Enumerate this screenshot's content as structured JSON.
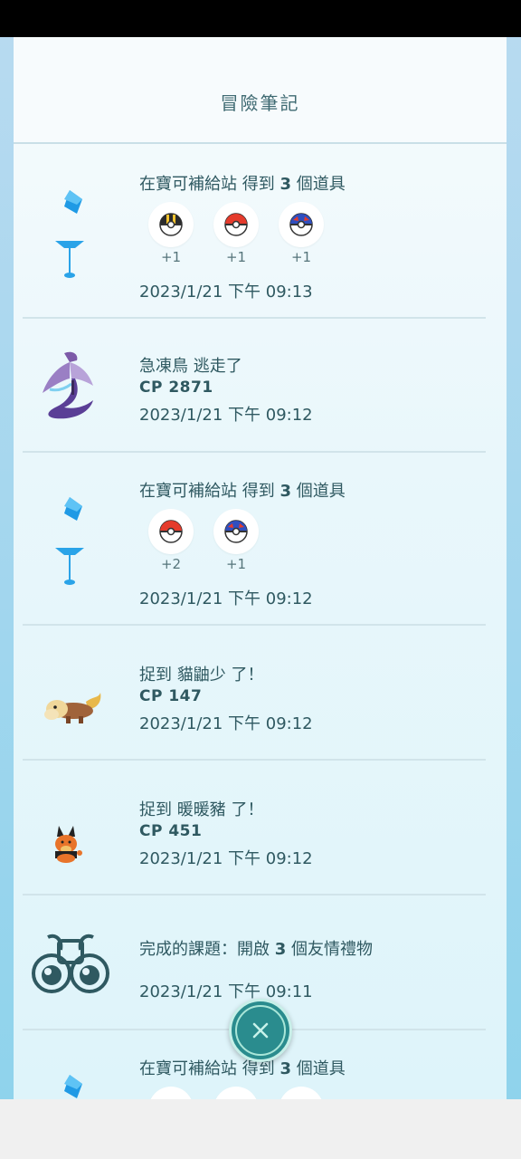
{
  "header": {
    "title": "冒險筆記"
  },
  "entries": [
    {
      "title_pre": "在寶可補給站  得到 ",
      "title_num": "3",
      "title_post": " 個道具",
      "items": [
        {
          "ball": "ultra-ball-icon",
          "count": "+1"
        },
        {
          "ball": "poke-ball-icon",
          "count": "+1"
        },
        {
          "ball": "great-ball-icon",
          "count": "+1"
        }
      ],
      "time": "2023/1/21 下午 09:13"
    },
    {
      "title": "急凍鳥 逃走了",
      "cp": "CP 2871",
      "time": "2023/1/21 下午 09:12"
    },
    {
      "title_pre": "在寶可補給站  得到 ",
      "title_num": "3",
      "title_post": " 個道具",
      "items": [
        {
          "ball": "poke-ball-icon",
          "count": "+2"
        },
        {
          "ball": "great-ball-icon",
          "count": "+1"
        }
      ],
      "time": "2023/1/21 下午 09:12"
    },
    {
      "title": "捉到 貓鼬少 了！",
      "cp": "CP 147",
      "time": "2023/1/21 下午 09:12"
    },
    {
      "title": "捉到 暖暖豬 了！",
      "cp": "CP 451",
      "time": "2023/1/21 下午 09:12"
    },
    {
      "title_pre": "完成的課題：開啟 ",
      "title_num": "3",
      "title_post": " 個友情禮物",
      "time": "2023/1/21 下午 09:11"
    },
    {
      "title_pre": "在寶可補給站  得到 ",
      "title_num": "3",
      "title_post": " 個道具"
    }
  ],
  "colors": {
    "accent": "#2a8c8e",
    "text": "#2f5961",
    "divider": "#d1e4ea"
  }
}
